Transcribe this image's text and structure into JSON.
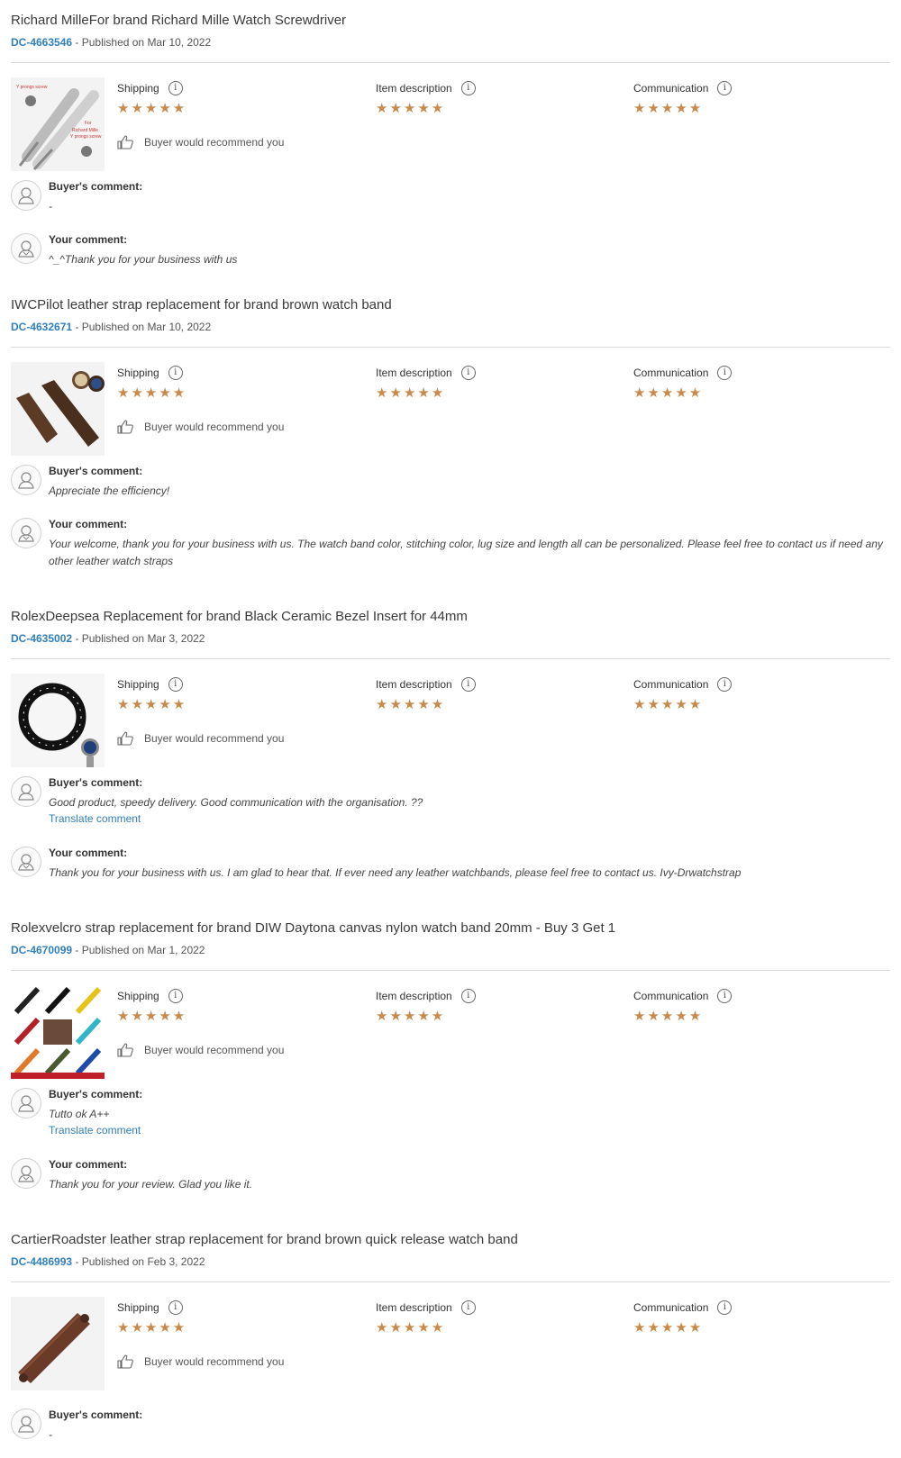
{
  "labels": {
    "shipping": "Shipping",
    "item_description": "Item description",
    "communication": "Communication",
    "recommend": "Buyer would recommend you",
    "buyer_comment": "Buyer's comment:",
    "your_comment": "Your comment:",
    "translate": "Translate comment",
    "stars": "★★★★★",
    "published_prefix": " - Published on "
  },
  "colors": {
    "star": "#c8894b",
    "link": "#2f7fbd"
  },
  "reviews": [
    {
      "title": "Richard MilleFor brand Richard Mille Watch Screwdriver",
      "id": "DC-4663546",
      "date": "Mar 10, 2022",
      "buyer_comment": "-",
      "your_comment": "^_^Thank you for your business with us",
      "image_text": [
        "Y prongs screw",
        "For",
        "Richard Mille",
        "Y prongs screw"
      ]
    },
    {
      "title": "IWCPilot leather strap replacement for brand brown watch band",
      "id": "DC-4632671",
      "date": "Mar 10, 2022",
      "buyer_comment": "Appreciate the efficiency!",
      "your_comment": "Your welcome, thank you for your business with us. The watch band color, stitching color, lug size and length all can be personalized. Please feel free to contact us if need any other leather watch straps"
    },
    {
      "title": "RolexDeepsea Replacement for brand Black Ceramic Bezel Insert for 44mm",
      "id": "DC-4635002",
      "date": "Mar 3, 2022",
      "buyer_comment": "Good product, speedy delivery. Good communication with the organisation. ??",
      "your_comment": "Thank you for your business with us. I am glad to hear that. If ever need any leather watchbands, please feel free to contact us. Ivy-Drwatchstrap"
    },
    {
      "title": "Rolexvelcro strap replacement for brand DIW Daytona canvas nylon watch band 20mm - Buy 3 Get 1",
      "id": "DC-4670099",
      "date": "Mar 1, 2022",
      "buyer_comment": "Tutto ok A++",
      "your_comment": "Thank you for your review. Glad you like it."
    },
    {
      "title": "CartierRoadster leather strap replacement for brand brown quick release watch band",
      "id": "DC-4486993",
      "date": "Feb 3, 2022",
      "buyer_comment": "-"
    }
  ]
}
